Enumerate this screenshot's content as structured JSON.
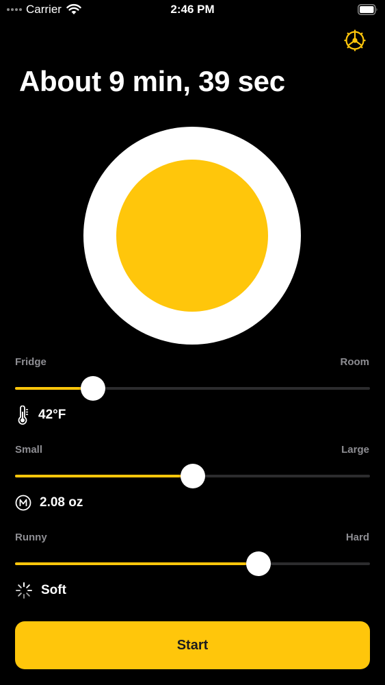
{
  "status_bar": {
    "carrier": "Carrier",
    "time": "2:46 PM",
    "wifi_icon": "wifi-icon",
    "battery_icon": "battery-icon"
  },
  "header": {
    "settings_icon": "settings-icon",
    "title": "About 9 min, 39 sec"
  },
  "egg": {
    "white_color": "#ffffff",
    "yolk_color": "#FFC60B"
  },
  "sliders": {
    "temperature": {
      "min_label": "Fridge",
      "max_label": "Room",
      "level": 0.22,
      "icon": "thermometer-icon",
      "value": "42°F"
    },
    "size": {
      "min_label": "Small",
      "max_label": "Large",
      "level": 0.5,
      "icon": "medium-size-icon",
      "value": "2.08 oz"
    },
    "doneness": {
      "min_label": "Runny",
      "max_label": "Hard",
      "level": 0.685,
      "icon": "doneness-spinner-icon",
      "value": "Soft"
    }
  },
  "start_button": {
    "label": "Start"
  },
  "colors": {
    "accent": "#FFC60B",
    "background": "#000000",
    "secondary_text": "#8E8E93",
    "track": "#2C2C2E"
  }
}
